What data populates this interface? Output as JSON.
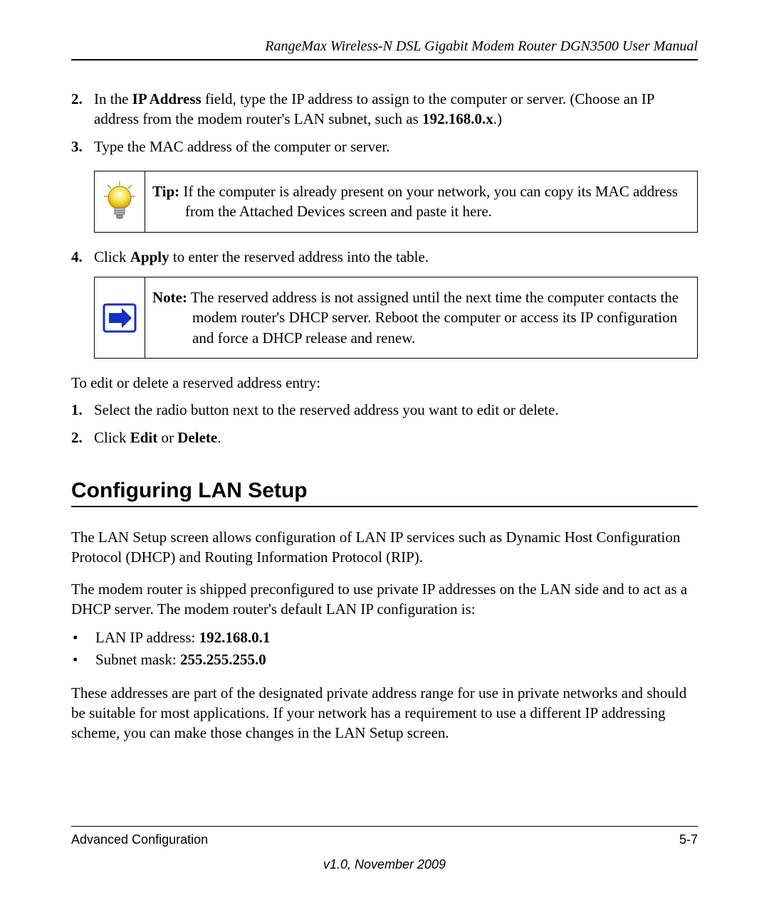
{
  "header": {
    "title": "RangeMax Wireless-N DSL Gigabit Modem Router DGN3500 User Manual"
  },
  "steps_a": {
    "item2": {
      "num": "2.",
      "t1": "In the ",
      "b1": "IP Address",
      "t2": " field, type the IP address to assign to the computer or server. (Choose an IP address from the modem router's LAN subnet, such as ",
      "b2": "192.168.0.x",
      "t3": ".)"
    },
    "item3": {
      "num": "3.",
      "t1": "Type the MAC address of the computer or server."
    },
    "item4": {
      "num": "4.",
      "t1": "Click ",
      "b1": "Apply",
      "t2": " to enter the reserved address into the table."
    }
  },
  "tip": {
    "label": "Tip:",
    "text": " If the computer is already present on your network, you can copy its MAC address from the Attached Devices screen and paste it here."
  },
  "note": {
    "label": "Note:",
    "text": " The reserved address is not assigned until the next time the computer contacts the modem router's DHCP server. Reboot the computer or access its IP configuration and force a DHCP release and renew."
  },
  "edit_intro": "To edit or delete a reserved address entry:",
  "steps_b": {
    "item1": {
      "num": "1.",
      "t1": "Select the radio button next to the reserved address you want to edit or delete."
    },
    "item2": {
      "num": "2.",
      "t1": "Click ",
      "b1": "Edit",
      "t2": " or ",
      "b2": "Delete",
      "t3": "."
    }
  },
  "section_heading": "Configuring LAN Setup",
  "lan_para1": "The LAN Setup screen allows configuration of LAN IP services such as Dynamic Host Configuration Protocol (DHCP) and Routing Information Protocol (RIP).",
  "lan_para2": "The modem router is shipped preconfigured to use private IP addresses on the LAN side and to act as a DHCP server. The modem router's default LAN IP configuration is:",
  "lan_bullets": {
    "b1_t1": "LAN IP address: ",
    "b1_b1": "192.168.0.1",
    "b2_t1": "Subnet mask: ",
    "b2_b1": "255.255.255.0"
  },
  "lan_para3": "These addresses are part of the designated private address range for use in private networks and should be suitable for most applications. If your network has a requirement to use a different IP addressing scheme, you can make those changes in the LAN Setup screen.",
  "footer": {
    "left": "Advanced Configuration",
    "right": "5-7",
    "version": "v1.0, November 2009"
  }
}
